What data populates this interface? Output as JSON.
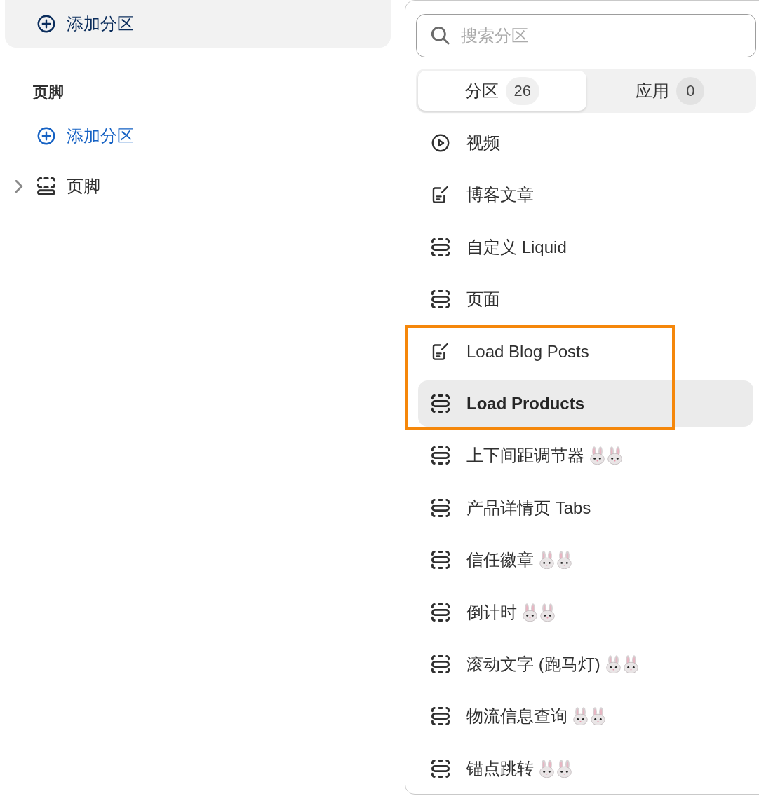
{
  "sidebar": {
    "add_section_button": {
      "label": "添加分区"
    },
    "footer_group": {
      "heading": "页脚",
      "add_section_link": {
        "label": "添加分区"
      },
      "tree": [
        {
          "label": "页脚",
          "expanded": false
        }
      ]
    }
  },
  "section_picker": {
    "search": {
      "placeholder": "搜索分区"
    },
    "tabs": [
      {
        "label": "分区",
        "count": "26",
        "selected": true
      },
      {
        "label": "应用",
        "count": "0",
        "selected": false
      }
    ],
    "items": [
      {
        "kind": "video",
        "label": "视频",
        "selected": false,
        "annotated": false,
        "marked": false
      },
      {
        "kind": "blog",
        "label": "博客文章",
        "selected": false,
        "annotated": false,
        "marked": false
      },
      {
        "kind": "section",
        "label": "自定义 Liquid",
        "selected": false,
        "annotated": false,
        "marked": false
      },
      {
        "kind": "section",
        "label": "页面",
        "selected": false,
        "annotated": false,
        "marked": false
      },
      {
        "kind": "blog",
        "label": "Load Blog Posts",
        "selected": false,
        "annotated": true,
        "marked": false
      },
      {
        "kind": "section",
        "label": "Load Products",
        "selected": true,
        "annotated": true,
        "marked": false
      },
      {
        "kind": "section",
        "label": "上下间距调节器",
        "selected": false,
        "annotated": false,
        "marked": true
      },
      {
        "kind": "section",
        "label": "产品详情页 Tabs",
        "selected": false,
        "annotated": false,
        "marked": false
      },
      {
        "kind": "section",
        "label": "信任徽章",
        "selected": false,
        "annotated": false,
        "marked": true
      },
      {
        "kind": "section",
        "label": "倒计时",
        "selected": false,
        "annotated": false,
        "marked": true
      },
      {
        "kind": "section",
        "label": "滚动文字 (跑马灯)",
        "selected": false,
        "annotated": false,
        "marked": true
      },
      {
        "kind": "section",
        "label": "物流信息查询",
        "selected": false,
        "annotated": false,
        "marked": true
      },
      {
        "kind": "section",
        "label": "锚点跳转",
        "selected": false,
        "annotated": false,
        "marked": true
      }
    ]
  }
}
